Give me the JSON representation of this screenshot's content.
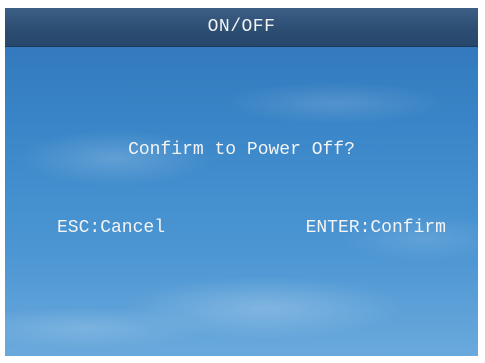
{
  "title_bar": {
    "title": "ON/OFF"
  },
  "dialog": {
    "message": "Confirm to Power Off?",
    "cancel_label": "ESC:Cancel",
    "confirm_label": "ENTER:Confirm"
  },
  "colors": {
    "title_bar_bg": "#2d4e73",
    "screen_bg": "#3a86c8",
    "text": "#f4f4f4"
  }
}
